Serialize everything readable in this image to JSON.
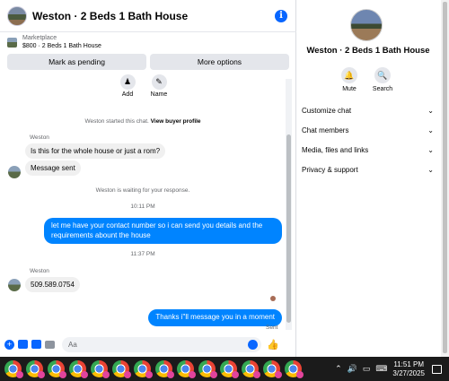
{
  "chat": {
    "title": "Weston · 2 Beds 1 Bath House",
    "info_icon": "info-icon",
    "marketplace_label": "Marketplace",
    "listing": "$800 · 2 Beds 1 Bath House",
    "mark_pending_label": "Mark as pending",
    "more_options_label": "More options",
    "quick_actions": [
      {
        "label": "Add",
        "icon": "add-person-icon"
      },
      {
        "label": "Name",
        "icon": "pencil-icon"
      }
    ],
    "started_text": "Weston started this chat.",
    "view_profile_link": "View buyer profile",
    "messages": {
      "sender1": "Weston",
      "in1": "Is this for the whole house or just a rom?",
      "in2": "Message sent",
      "waiting": "Weston is waiting for your response.",
      "time1": "10:11 PM",
      "out1": "let me have your contact number so i can send you details and the requirements abount the house",
      "time2": "11:37 PM",
      "sender2": "Weston",
      "in3": "509.589.0754",
      "out2": "Thanks i\"ll message you in a moment",
      "status": "Sent"
    },
    "composer_placeholder": "Aa"
  },
  "side": {
    "title": "Weston · 2 Beds 1 Bath House",
    "actions": [
      {
        "label": "Mute",
        "icon": "bell-icon"
      },
      {
        "label": "Search",
        "icon": "search-icon"
      }
    ],
    "menu": [
      "Customize chat",
      "Chat members",
      "Media, files and links",
      "Privacy & support"
    ]
  },
  "taskbar": {
    "time": "11:51 PM",
    "date": "3/27/2025",
    "app_count": 14
  },
  "colors": {
    "accent": "#0866ff",
    "bubble_out": "#0084ff",
    "bubble_in": "#f0f0f0"
  }
}
